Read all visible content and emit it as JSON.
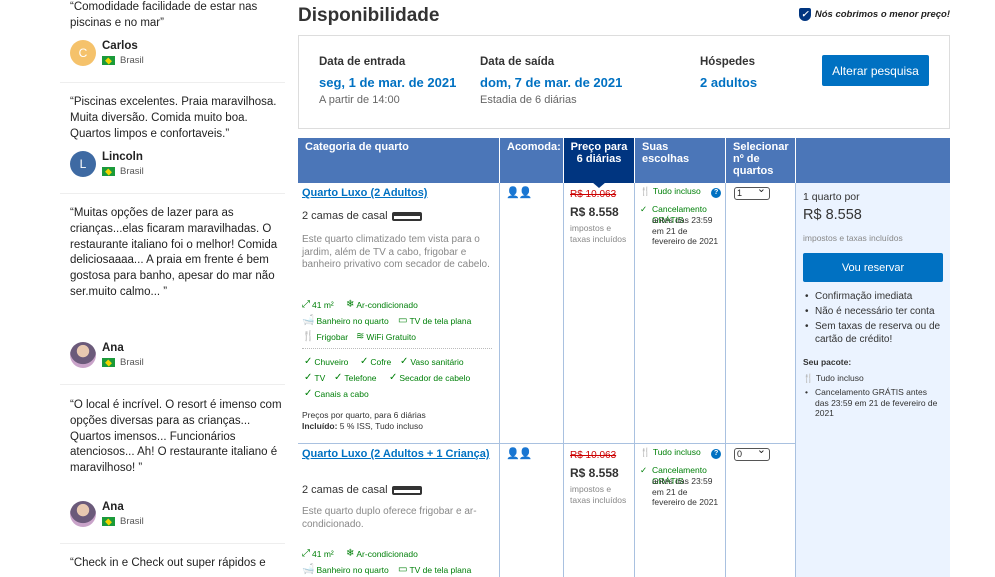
{
  "reviews": [
    {
      "text": "“Comodidade facilidade de estar nas piscinas e no mar”",
      "author": "Carlos",
      "initial": "C",
      "avatar_color": "#f5c26b",
      "country": "Brasil"
    },
    {
      "text": "“Piscinas excelentes. Praia maravilhosa. Muita diversão. Comida muito boa. Quartos limpos e confortaveis.”",
      "author": "Lincoln",
      "initial": "L",
      "avatar_color": "#3e6aa3",
      "country": "Brasil"
    },
    {
      "text": "“Muitas opções de lazer para as crianças...elas ficaram maravilhadas. O restaurante italiano foi o melhor! Comida deliciosaaaa... A praia em frente é bem gostosa para banho, apesar do mar não ser.muito calmo... ”",
      "author": "Ana",
      "country": "Brasil"
    },
    {
      "text": "“O local é incrível. O resort é imenso com opções diversas para as crianças... Quartos imensos... Funcionários atenciosos... Ah! O restaurante italiano é maravilhoso! ”",
      "author": "Ana",
      "country": "Brasil"
    },
    {
      "text": "“Check in e Check out super rápidos e"
    }
  ],
  "availability": {
    "title": "Disponibilidade",
    "best_price": "Nós cobrimos o menor preço!"
  },
  "search": {
    "checkin_label": "Data de entrada",
    "checkin_value": "seg, 1 de mar. de 2021",
    "checkin_sub": "A partir de 14:00",
    "checkout_label": "Data de saída",
    "checkout_value": "dom, 7 de mar. de 2021",
    "checkout_sub": "Estadia de 6 diárias",
    "guests_label": "Hóspedes",
    "guests_value": "2 adultos",
    "change_button": "Alterar pesquisa"
  },
  "table": {
    "headers": {
      "room_type": "Categoria de quarto",
      "sleeps": "Acomoda:",
      "price": "Preço para 6 diárias",
      "choices": "Suas escolhas",
      "select": "Selecionar nº de quartos"
    },
    "rooms": [
      {
        "name": "Quarto Luxo (2 Adultos)",
        "beds": "2 camas de casal",
        "description": "Este quarto climatizado tem vista para o jardim, além de TV a cabo, frigobar e banheiro privativo com secador de cabelo.",
        "facilities": [
          "41 m²",
          "Ar-condicionado",
          "Banheiro no quarto",
          "TV de tela plana",
          "Frigobar",
          "WiFi Gratuito"
        ],
        "amenities": [
          "Chuveiro",
          "Cofre",
          "Vaso sanitário",
          "TV",
          "Telefone",
          "Secador de cabelo",
          "Canais a cabo"
        ],
        "price_note": "Preços por quarto, para 6 diárias",
        "included_label": "Incluído:",
        "included": "5 % ISS, Tudo incluso",
        "old_price": "R$ 10.063",
        "price": "R$ 8.558",
        "tax": "impostos e taxas incluídos",
        "meal": "Tudo incluso",
        "cancel_free": "Cancelamento GRÁTIS",
        "cancel_until": "antes das 23:59 em 21 de fevereiro de 2021",
        "select_value": "1"
      },
      {
        "name": "Quarto Luxo (2 Adultos + 1 Criança)",
        "beds": "2 camas de casal",
        "description": "Este quarto duplo oferece frigobar e ar-condicionado.",
        "facilities": [
          "41 m²",
          "Ar-condicionado",
          "Banheiro no quarto",
          "TV de tela plana"
        ],
        "old_price": "R$ 10.063",
        "price": "R$ 8.558",
        "tax": "impostos e taxas incluídos",
        "meal": "Tudo incluso",
        "cancel_free": "Cancelamento GRÁTIS",
        "cancel_until": "antes das 23:59 em 21 de fevereiro de 2021",
        "select_value": "0"
      }
    ]
  },
  "summary": {
    "rooms_label": "1 quarto por",
    "price": "R$ 8.558",
    "tax": "impostos e taxas incluídos",
    "reserve_button": "Vou reservar",
    "bullets": [
      "Confirmação imediata",
      "Não é necessário ter conta",
      "Sem taxas de reserva ou de cartão de crédito!"
    ],
    "package_title": "Seu pacote:",
    "package_meal": "Tudo incluso",
    "package_cancel": "Cancelamento GRÁTIS antes das 23:59 em 21 de fevereiro de 2021"
  }
}
